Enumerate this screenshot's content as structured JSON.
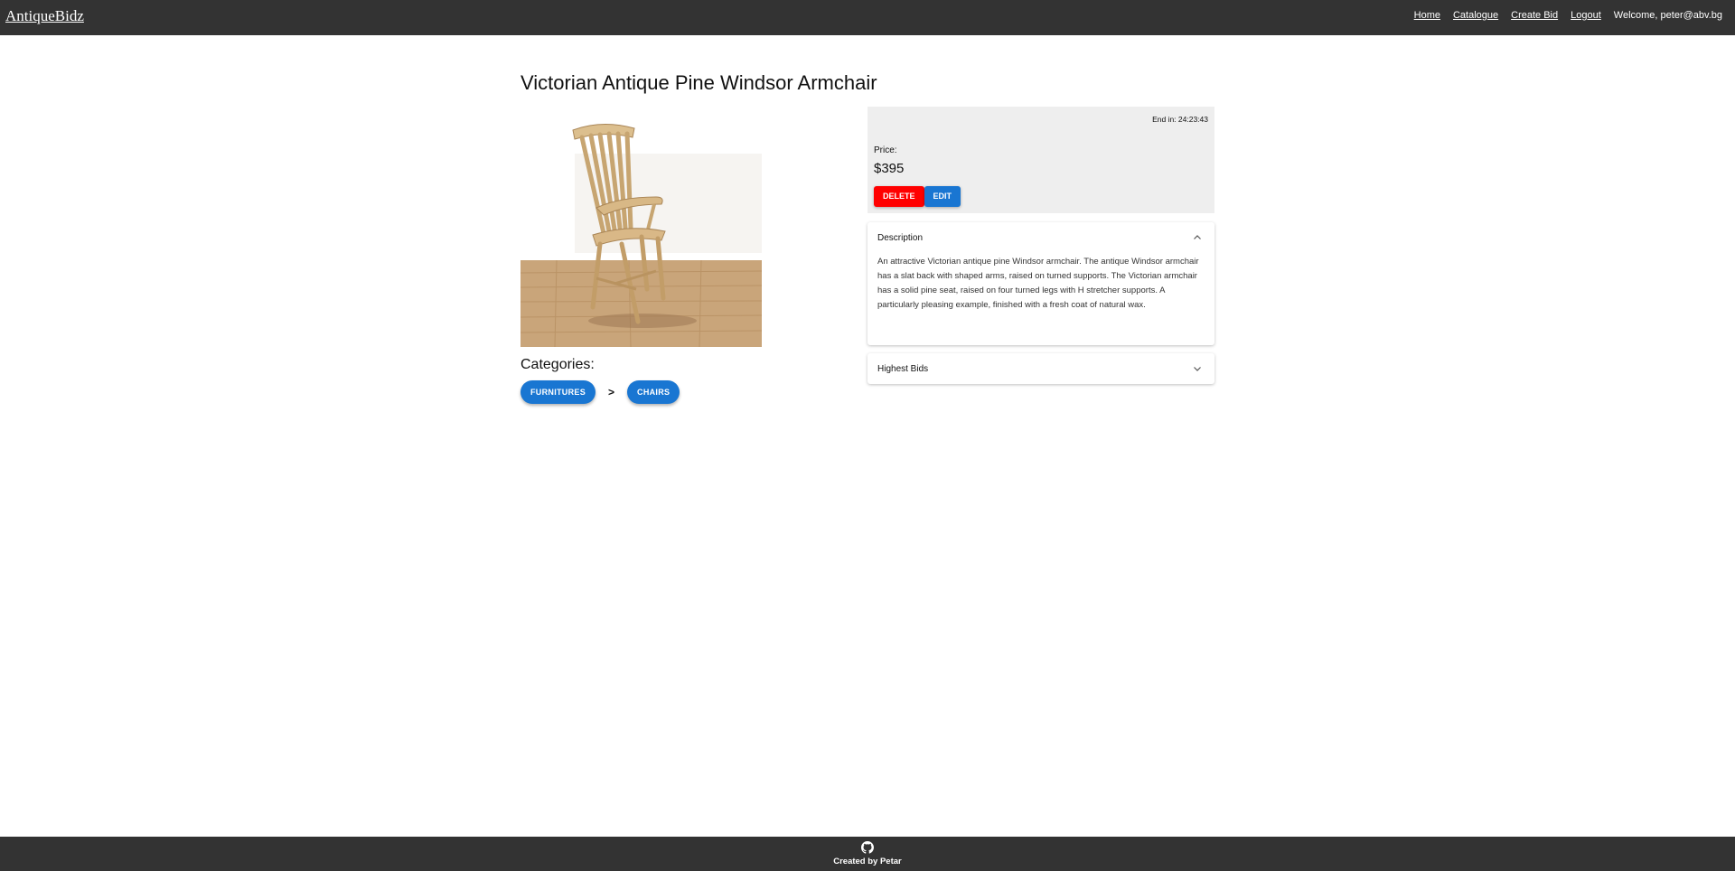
{
  "header": {
    "brand": "AntiqueBidz",
    "nav": [
      "Home",
      "Catalogue",
      "Create Bid",
      "Logout"
    ],
    "welcome": "Welcome, peter@abv.bg"
  },
  "item": {
    "title": "Victorian Antique Pine Windsor Armchair",
    "image_alt": "chair-photo",
    "categories_heading": "Categories:",
    "categories": [
      "FURNITURES",
      "CHAIRS"
    ],
    "category_separator": ">",
    "end_label": "End in: 24:23:43",
    "price_label": "Price:",
    "price": "$395",
    "delete_label": "DELETE",
    "edit_label": "EDIT",
    "description_title": "Description",
    "description": "An attractive Victorian antique pine Windsor armchair. The antique Windsor armchair has a slat back with shaped arms, raised on turned supports. The Victorian armchair has a solid pine seat, raised on four turned legs with H stretcher supports. A particularly pleasing example, finished with a fresh coat of natural wax.",
    "bids_title": "Highest Bids"
  },
  "footer": {
    "icon": "github-icon",
    "text": "Created by Petar"
  },
  "colors": {
    "topbar": "#333333",
    "accent": "#1976d2",
    "danger": "#ff0000",
    "panel": "#eeeeee"
  }
}
